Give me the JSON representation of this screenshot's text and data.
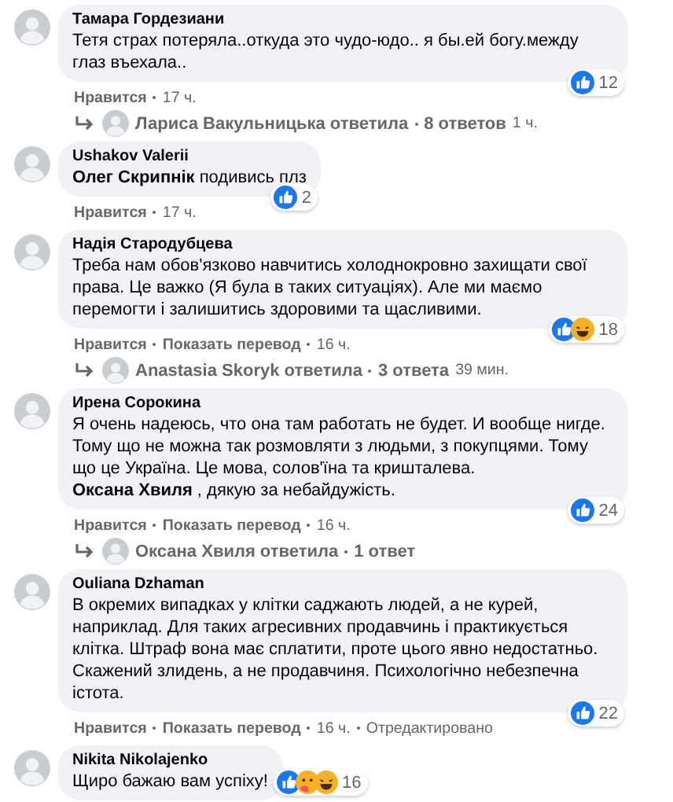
{
  "comments": [
    {
      "author": "Тамара Гордезиани",
      "text": "Тетя страх потеряла..откуда это чудо-юдо.. я бы.ей богу.между глаз въехала..",
      "reactions": [
        {
          "kind": "like"
        }
      ],
      "reaction_count": "12",
      "actions": [
        "Нравится"
      ],
      "time": "17 ч.",
      "reply": {
        "author": "Лариса Вакульницька ответила",
        "count": "8 ответов",
        "time": "1 ч."
      }
    },
    {
      "author": "Ushakov Valerii",
      "text": "**Олег Скрипнік** подивись плз",
      "reactions": [
        {
          "kind": "like"
        }
      ],
      "reaction_count": "2",
      "actions": [
        "Нравится"
      ],
      "time": "17 ч."
    },
    {
      "author": "Надія Стародубцева",
      "text": "Треба нам обов'язково навчитись холоднокровно захищати свої права. Це важко (Я була в таких ситуаціях). Але ми маємо перемогти і залишитись здоровими та щасливими.",
      "reactions": [
        {
          "kind": "like"
        },
        {
          "kind": "haha"
        }
      ],
      "reaction_count": "18",
      "actions": [
        "Нравится",
        "Показать перевод"
      ],
      "time": "16 ч.",
      "reply": {
        "author": "Anastasia Skoryk ответила",
        "count": "3 ответа",
        "time": "39 мин."
      }
    },
    {
      "author": "Ирена Сорокина",
      "text": "Я очень надеюсь, что она там работать не будет. И вообще нигде. Тому що не можна так розмовляти з людьми, з покупцями. Тому що це Україна. Це мова, солов'їна та кришталева.\n**Оксана Хвиля** , дякую за небайдужість.",
      "reactions": [
        {
          "kind": "like"
        }
      ],
      "reaction_count": "24",
      "actions": [
        "Нравится",
        "Показать перевод"
      ],
      "time": "16 ч.",
      "reply": {
        "author": "Оксана Хвиля ответила",
        "count": "1 ответ"
      }
    },
    {
      "author": "Ouliana Dzhaman",
      "text": "В окремих випадках у клітки саджають людей, а не курей, наприклад. Для таких агресивних продавчинь і практикується клітка. Штраф вона має сплатити, проте цього явно недостатньо. Скажений злидень, а не продавчиня. Психологічно небезпечна істота.",
      "reactions": [
        {
          "kind": "like"
        }
      ],
      "reaction_count": "22",
      "actions": [
        "Нравится",
        "Показать перевод"
      ],
      "time": "16 ч.",
      "edited": "Отредактировано"
    },
    {
      "author": "Nikita Nikolajenko",
      "text": "Щиро бажаю вам успіху!",
      "reactions": [
        {
          "kind": "like"
        },
        {
          "kind": "care"
        },
        {
          "kind": "haha"
        }
      ],
      "reaction_count": "16"
    }
  ]
}
